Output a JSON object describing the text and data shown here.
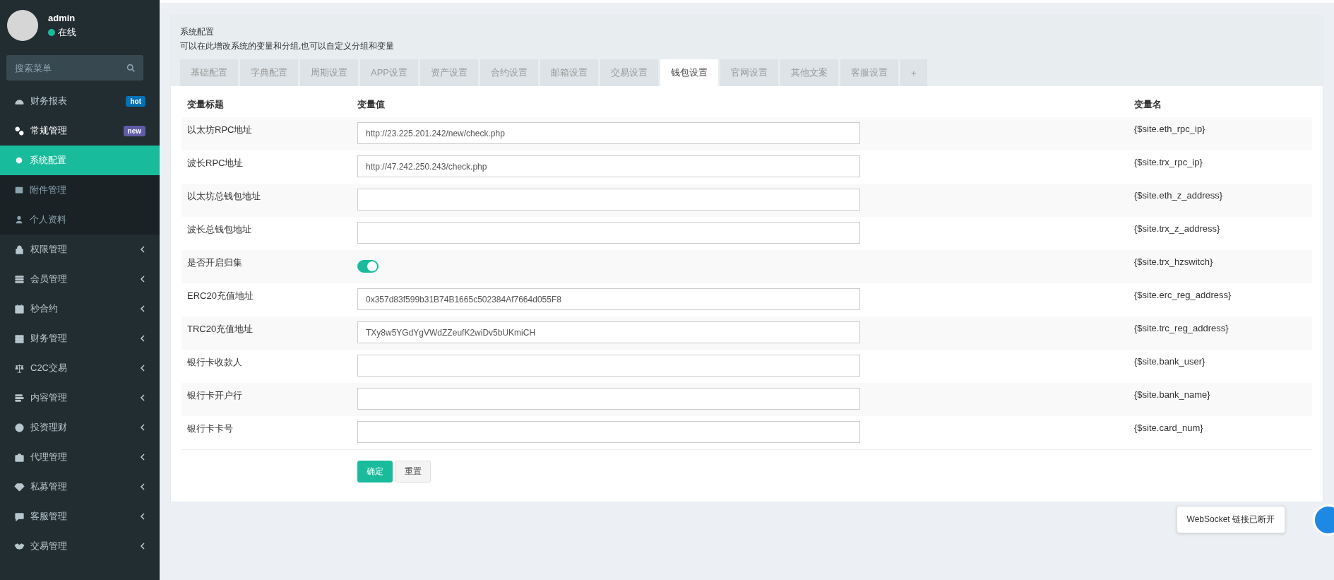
{
  "user": {
    "name": "admin",
    "status": "在线"
  },
  "search": {
    "placeholder": "搜索菜单"
  },
  "sidebar": {
    "items": [
      {
        "label": "财务报表",
        "badge": {
          "text": "hot",
          "color": "#0073b7"
        },
        "selected": false
      },
      {
        "label": "常规管理",
        "badge": {
          "text": "new",
          "color": "#605ca8"
        },
        "selected": false,
        "expanded": true,
        "children": [
          {
            "label": "系统配置",
            "selected": true
          },
          {
            "label": "附件管理",
            "selected": false
          },
          {
            "label": "个人资料",
            "selected": false
          }
        ]
      },
      {
        "label": "权限管理",
        "selected": false,
        "expanded": false
      },
      {
        "label": "会员管理",
        "selected": false,
        "expanded": false
      },
      {
        "label": "秒合约",
        "selected": false,
        "expanded": false
      },
      {
        "label": "财务管理",
        "selected": false,
        "expanded": false
      },
      {
        "label": "C2C交易",
        "selected": false,
        "expanded": false
      },
      {
        "label": "内容管理",
        "selected": false,
        "expanded": false
      },
      {
        "label": "投资理财",
        "selected": false,
        "expanded": false
      },
      {
        "label": "代理管理",
        "selected": false,
        "expanded": false
      },
      {
        "label": "私募管理",
        "selected": false,
        "expanded": false
      },
      {
        "label": "客服管理",
        "selected": false,
        "expanded": false
      },
      {
        "label": "交易管理",
        "selected": false,
        "expanded": false
      }
    ]
  },
  "panel": {
    "title": "系统配置",
    "description": "可以在此增改系统的变量和分组,也可以自定义分组和变量"
  },
  "tabs": [
    {
      "label": "基础配置",
      "selected": false
    },
    {
      "label": "字典配置",
      "selected": false
    },
    {
      "label": "周期设置",
      "selected": false
    },
    {
      "label": "APP设置",
      "selected": false
    },
    {
      "label": "资产设置",
      "selected": false
    },
    {
      "label": "合约设置",
      "selected": false
    },
    {
      "label": "邮箱设置",
      "selected": false
    },
    {
      "label": "交易设置",
      "selected": false
    },
    {
      "label": "钱包设置",
      "selected": true
    },
    {
      "label": "官网设置",
      "selected": false
    },
    {
      "label": "其他文案",
      "selected": false
    },
    {
      "label": "客服设置",
      "selected": false
    },
    {
      "label": "+",
      "selected": false
    }
  ],
  "table": {
    "columns": [
      "变量标题",
      "变量值",
      "变量名"
    ],
    "rows": [
      {
        "title": "以太坊RPC地址",
        "kind": "input",
        "value": "http://23.225.201.242/new/check.php",
        "name": "{$site.eth_rpc_ip}"
      },
      {
        "title": "波长RPC地址",
        "kind": "input",
        "value": "http://47.242.250.243/check.php",
        "name": "{$site.trx_rpc_ip}"
      },
      {
        "title": "以太坊总钱包地址",
        "kind": "input",
        "value": "",
        "name": "{$site.eth_z_address}"
      },
      {
        "title": "波长总钱包地址",
        "kind": "input",
        "value": "",
        "name": "{$site.trx_z_address}"
      },
      {
        "title": "是否开启归集",
        "kind": "switch",
        "on": true,
        "name": "{$site.trx_hzswitch}"
      },
      {
        "title": "ERC20充值地址",
        "kind": "input",
        "value": "0x357d83f599b31B74B1665c502384Af7664d055F8",
        "name": "{$site.erc_reg_address}"
      },
      {
        "title": "TRC20充值地址",
        "kind": "input",
        "value": "TXy8w5YGdYgVWdZZeufK2wiDv5bUKmiCH",
        "name": "{$site.trc_reg_address}"
      },
      {
        "title": "银行卡收款人",
        "kind": "input",
        "value": "",
        "name": "{$site.bank_user}"
      },
      {
        "title": "银行卡开户行",
        "kind": "input",
        "value": "",
        "name": "{$site.bank_name}"
      },
      {
        "title": "银行卡卡号",
        "kind": "input",
        "value": "",
        "name": "{$site.card_num}"
      }
    ]
  },
  "buttons": [
    {
      "label": "确定",
      "kind": "primary"
    },
    {
      "label": "重置",
      "kind": "default"
    }
  ],
  "toast": {
    "text": "WebSocket 链接已断开"
  }
}
